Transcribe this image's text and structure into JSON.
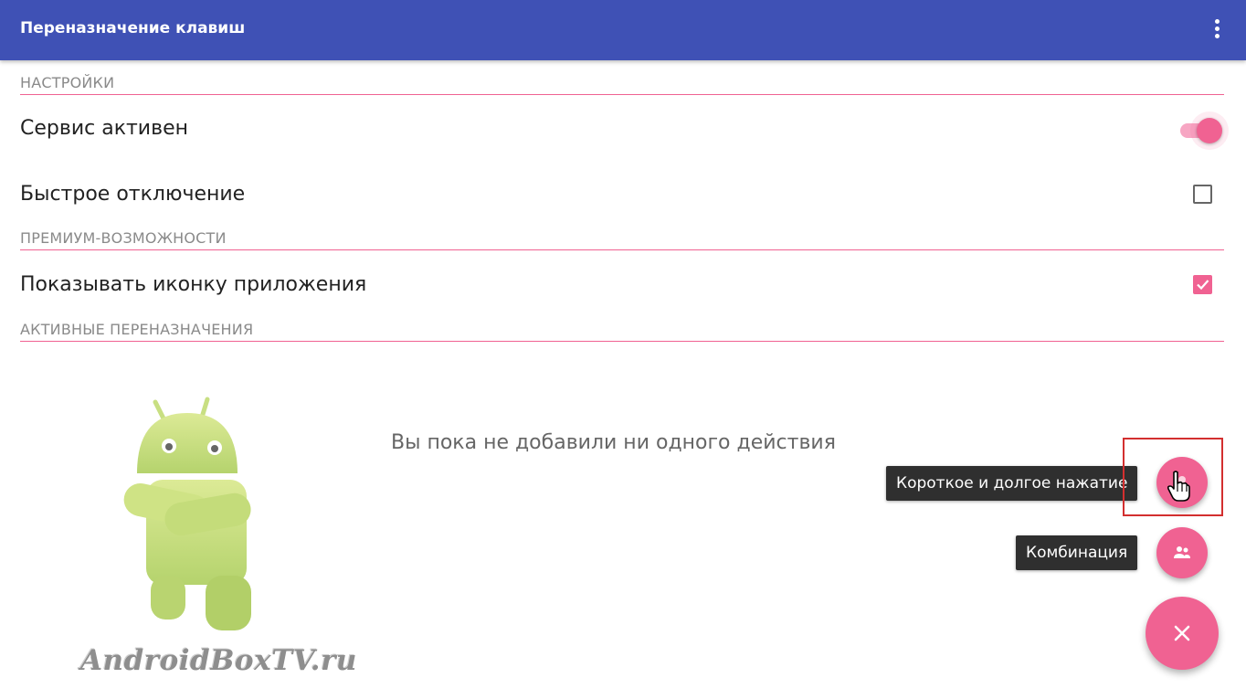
{
  "appbar": {
    "title": "Переназначение клавиш",
    "menu_icon": "more-vert-icon",
    "color": "#3f51b5"
  },
  "sections": {
    "settings": "НАСТРОЙКИ",
    "premium": "ПРЕМИУМ-ВОЗМОЖНОСТИ",
    "active": "АКТИВНЫЕ ПЕРЕНАЗНАЧЕНИЯ"
  },
  "prefs": {
    "service_active": {
      "label": "Сервис активен",
      "on": true
    },
    "quick_disable": {
      "label": "Быстрое отключение",
      "checked": false
    },
    "show_icon": {
      "label": "Показывать иконку приложения",
      "checked": true
    }
  },
  "empty_state": "Вы пока не добавили ни одного действия",
  "fab_menu": {
    "short_long_press": "Короткое и долгое нажатие",
    "combination": "Комбинация",
    "close_icon": "close-icon"
  },
  "watermark": "AndroidBoxTV.ru",
  "accent_color": "#f06292"
}
